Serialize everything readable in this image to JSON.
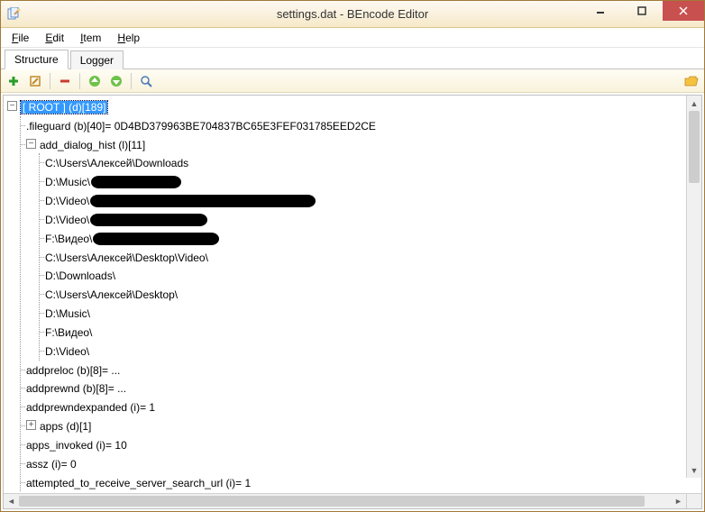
{
  "window": {
    "title": "settings.dat - BEncode Editor"
  },
  "menu": {
    "file": "File",
    "edit": "Edit",
    "item": "Item",
    "help": "Help"
  },
  "tabs": {
    "structure": "Structure",
    "logger": "Logger"
  },
  "toolbar": {
    "add": "add-icon",
    "edit": "edit-icon",
    "delete": "delete-icon",
    "moveup": "move-up-icon",
    "movedown": "move-down-icon",
    "search": "search-icon",
    "folder": "open-folder-icon"
  },
  "tree": {
    "root_label": "[ ROOT ] (d)[189]",
    "fileguard": ".fileguard (b)[40]= 0D4BD379963BE704837BC65E3FEF031785EED2CE",
    "add_dialog_hist": "add_dialog_hist (l)[11]",
    "hist": [
      "C:\\Users\\Алексей\\Downloads",
      "D:\\Music\\",
      "D:\\Video\\",
      "D:\\Video\\",
      "F:\\Видео\\",
      "C:\\Users\\Алексей\\Desktop\\Video\\",
      "D:\\Downloads\\",
      "C:\\Users\\Алексей\\Desktop\\",
      "D:\\Music\\",
      "F:\\Видео\\",
      "D:\\Video\\"
    ],
    "redact_widths": [
      0,
      100,
      250,
      130,
      140,
      0,
      0,
      0,
      0,
      0,
      0
    ],
    "addpreloc": "addpreloc (b)[8]= ...",
    "addprewnd": "addprewnd (b)[8]= ...",
    "addprewndexpanded": "addprewndexpanded (i)= 1",
    "apps": "apps (d)[1]",
    "apps_invoked": "apps_invoked (i)= 10",
    "assz": "assz (i)= 0",
    "attempted": "attempted_to_receive_server_search_url (i)= 1"
  }
}
